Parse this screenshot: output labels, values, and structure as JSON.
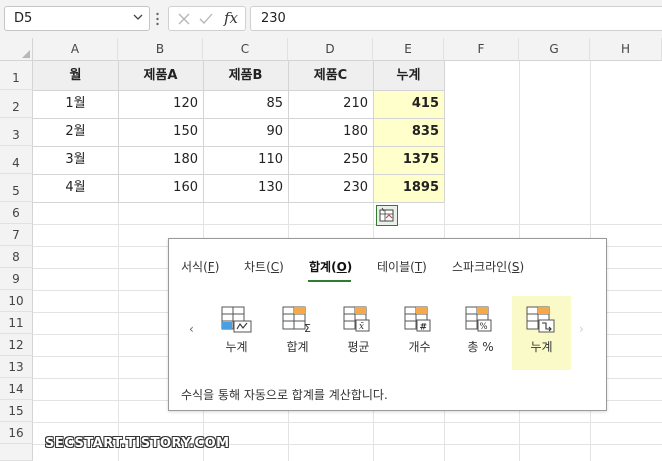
{
  "formula_bar": {
    "name_box": "D5",
    "formula": "230",
    "fx_label": "fx"
  },
  "columns": [
    "A",
    "B",
    "C",
    "D",
    "E",
    "F",
    "G",
    "H"
  ],
  "rows": [
    "1",
    "2",
    "3",
    "4",
    "5",
    "6",
    "7",
    "8",
    "9",
    "10",
    "11",
    "12",
    "13",
    "14",
    "15",
    "16"
  ],
  "table": {
    "headers": [
      "월",
      "제품A",
      "제품B",
      "제품C",
      "누계"
    ],
    "rows": [
      [
        "1월",
        "120",
        "85",
        "210",
        "415"
      ],
      [
        "2월",
        "150",
        "90",
        "180",
        "835"
      ],
      [
        "3월",
        "180",
        "110",
        "250",
        "1375"
      ],
      [
        "4월",
        "160",
        "130",
        "230",
        "1895"
      ]
    ]
  },
  "quick_analysis": {
    "tabs": [
      {
        "label": "서식",
        "key": "F"
      },
      {
        "label": "차트",
        "key": "C"
      },
      {
        "label": "합계",
        "key": "O"
      },
      {
        "label": "테이블",
        "key": "T"
      },
      {
        "label": "스파크라인",
        "key": "S"
      }
    ],
    "active_tab": "합계",
    "tools": [
      "누계",
      "합계",
      "평균",
      "개수",
      "총 %",
      "누계"
    ],
    "selected_tool_index": 5,
    "description": "수식을 통해 자동으로 합계를 계산합니다.",
    "nav_prev": "‹",
    "nav_next": "›"
  },
  "watermark": "SECSTART.TISTORY.COM",
  "colors": {
    "accent": "#2e7d32",
    "highlight": "#ffffcc",
    "selected_tool": "#fafac8"
  }
}
